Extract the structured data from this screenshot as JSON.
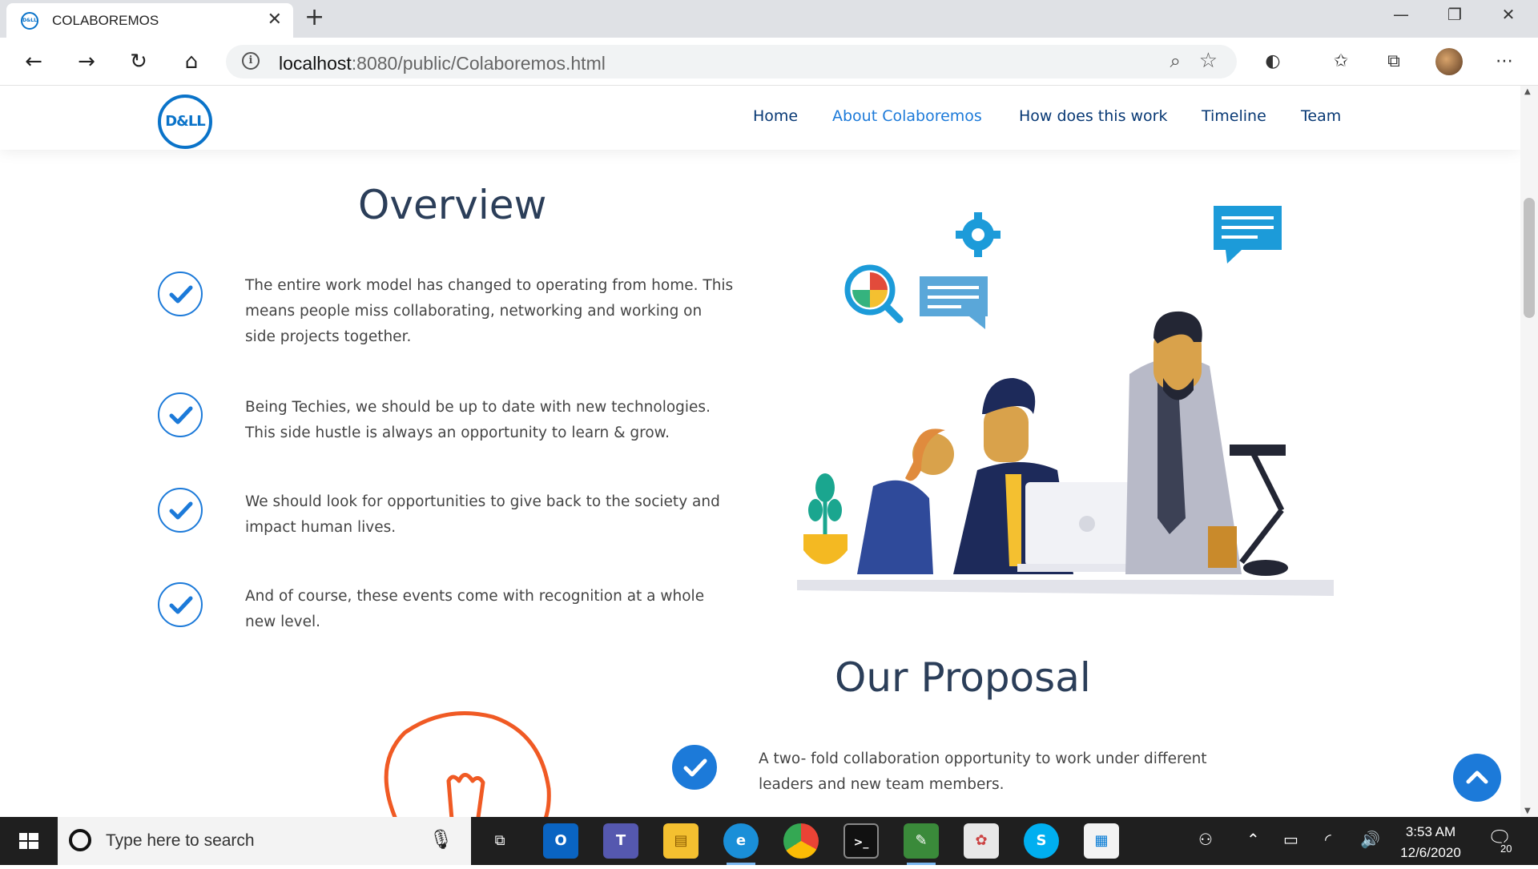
{
  "browser": {
    "tab_title": "COLABOREMOS",
    "tab_favicon_text": "D&LL",
    "url_host": "localhost",
    "url_rest": ":8080/public/Colaboremos.html"
  },
  "site": {
    "logo_text": "D&LL",
    "nav": [
      {
        "label": "Home"
      },
      {
        "label": "About Colaboremos"
      },
      {
        "label": "How does this work"
      },
      {
        "label": "Timeline"
      },
      {
        "label": "Team"
      }
    ],
    "overview": {
      "title": "Overview",
      "items": [
        "The entire work model has changed to operating from home. This means people miss collaborating, networking and working on side projects together.",
        "Being Techies, we should be up to date with new technologies. This side hustle is always an opportunity to learn & grow.",
        "We should look for opportunities to give back to the society and impact human lives.",
        "And of course, these events come with recognition at a whole new level."
      ]
    },
    "proposal": {
      "title": "Our Proposal",
      "items": [
        "A two- fold collaboration opportunity to work under different leaders and new team members."
      ]
    }
  },
  "taskbar": {
    "search_placeholder": "Type here to search",
    "time": "3:53 AM",
    "date": "12/6/2020",
    "notifications": "20"
  },
  "colors": {
    "accent": "#1c7ad9",
    "heading": "#2b3e59",
    "nav": "#073874",
    "taskbar": "#1f1f1f"
  },
  "icons": [
    "info-icon",
    "zoom-icon",
    "favorite-star-icon",
    "scroll-top-icon",
    "windows-start-icon",
    "search-circle-icon",
    "microphone-icon",
    "task-view-icon",
    "outlook-icon",
    "teams-icon",
    "file-explorer-icon",
    "edge-icon",
    "chrome-icon",
    "terminal-icon",
    "notepad-icon",
    "paint-icon",
    "skype-icon",
    "store-icon",
    "people-icon",
    "battery-icon",
    "wifi-icon",
    "volume-icon",
    "notification-icon"
  ]
}
